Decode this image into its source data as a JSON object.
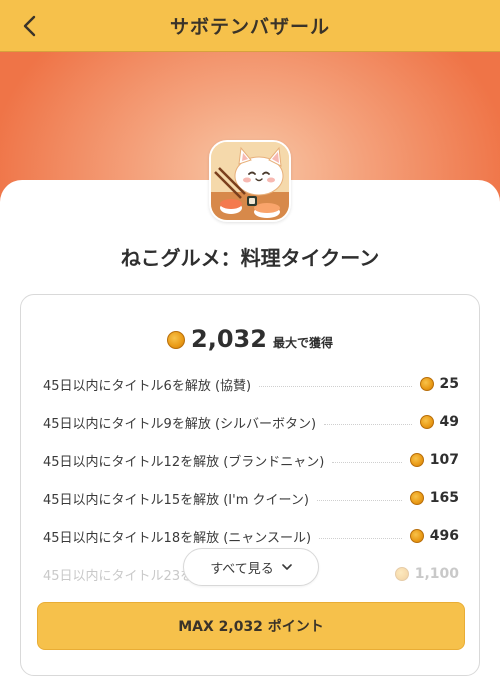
{
  "header": {
    "title": "サボテンバザール",
    "back_icon": "chevron-left-icon"
  },
  "app": {
    "title": "ねこグルメ：料理タイクーン",
    "icon": "cat-sushi-app-icon"
  },
  "summary": {
    "total": "2,032",
    "suffix": "最大で獲得"
  },
  "rewards": [
    {
      "label": "45日以内にタイトル6を解放 (協賛)",
      "points": "25"
    },
    {
      "label": "45日以内にタイトル9を解放 (シルバーボタン)",
      "points": "49"
    },
    {
      "label": "45日以内にタイトル12を解放 (ブランドニャン)",
      "points": "107"
    },
    {
      "label": "45日以内にタイトル15を解放 (I'm クイーン)",
      "points": "165"
    },
    {
      "label": "45日以内にタイトル18を解放 (ニャンスール)",
      "points": "496"
    },
    {
      "label": "45日以内にタイトル23を解",
      "points": "1,100"
    }
  ],
  "see_all": {
    "label": "すべて見る"
  },
  "cta": {
    "label": "MAX 2,032 ポイント"
  },
  "colors": {
    "accent": "#f6c14b",
    "hero": "#ef7447",
    "coin": "#e99a16"
  }
}
